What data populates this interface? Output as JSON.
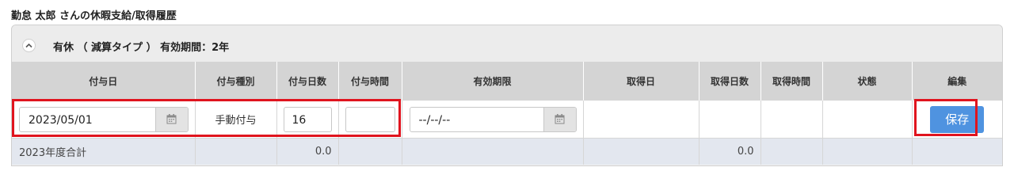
{
  "page_title": "勤怠 太郎 さんの休暇支給/取得履歴",
  "panel": {
    "title": "有休 （ 減算タイプ ） 有効期間：2年"
  },
  "columns": [
    "付与日",
    "付与種別",
    "付与日数",
    "付与時間",
    "有効期限",
    "取得日",
    "取得日数",
    "取得時間",
    "状態",
    "編集"
  ],
  "edit_row": {
    "grant_date": "2023/05/01",
    "grant_type": "手動付与",
    "grant_days": "16",
    "grant_hours": "",
    "expiry_date": "--/--/--",
    "save_label": "保存"
  },
  "total_row": {
    "label": "2023年度合計",
    "grant_days_total": "0.0",
    "acquired_days_total": "0.0"
  },
  "colors": {
    "highlight": "#e0141e",
    "save_button": "#4f93e0",
    "header_bg": "#d4d4d4",
    "total_row_bg": "#e3e7ef"
  },
  "icons": [
    "chevron-up-icon",
    "calendar-icon"
  ]
}
